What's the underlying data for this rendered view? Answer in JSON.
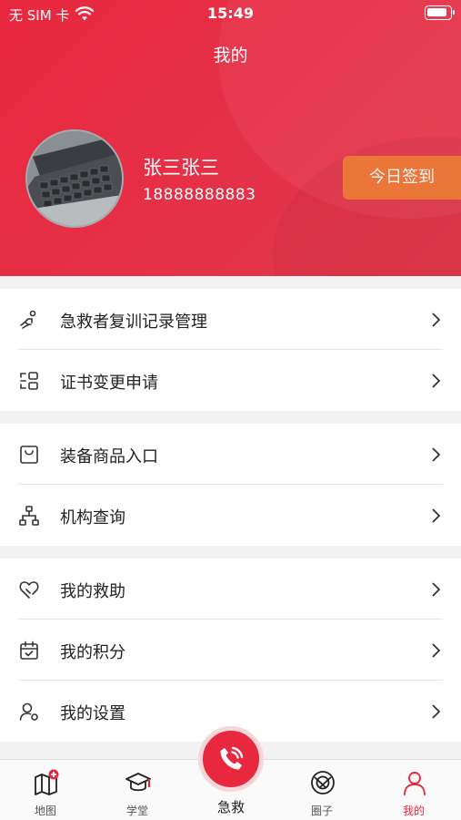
{
  "status_bar": {
    "carrier": "无 SIM 卡",
    "time": "15:49"
  },
  "header": {
    "title": "我的"
  },
  "profile": {
    "name": "张三张三",
    "phone": "18888888883",
    "checkin_label": "今日签到"
  },
  "menu": {
    "groups": [
      {
        "items": [
          {
            "icon": "baby-carry-icon",
            "label": "急救者复训记录管理"
          },
          {
            "icon": "certificate-icon",
            "label": "证书变更申请"
          }
        ]
      },
      {
        "items": [
          {
            "icon": "shopping-bag-icon",
            "label": "装备商品入口"
          },
          {
            "icon": "org-chart-icon",
            "label": "机构查询"
          }
        ]
      },
      {
        "items": [
          {
            "icon": "heart-hand-icon",
            "label": "我的救助"
          },
          {
            "icon": "calendar-check-icon",
            "label": "我的积分"
          },
          {
            "icon": "user-settings-icon",
            "label": "我的设置"
          }
        ]
      }
    ]
  },
  "tab_bar": {
    "tabs": [
      {
        "icon": "map-icon",
        "label": "地图"
      },
      {
        "icon": "graduation-cap-icon",
        "label": "学堂"
      },
      {
        "icon": "phone-icon",
        "label": "急救"
      },
      {
        "icon": "circle-icon",
        "label": "圈子"
      },
      {
        "icon": "user-icon",
        "label": "我的"
      }
    ],
    "active_tab": "我的"
  },
  "colors": {
    "brand_red": "#e8283e",
    "checkin_orange": "#f47b3c"
  }
}
